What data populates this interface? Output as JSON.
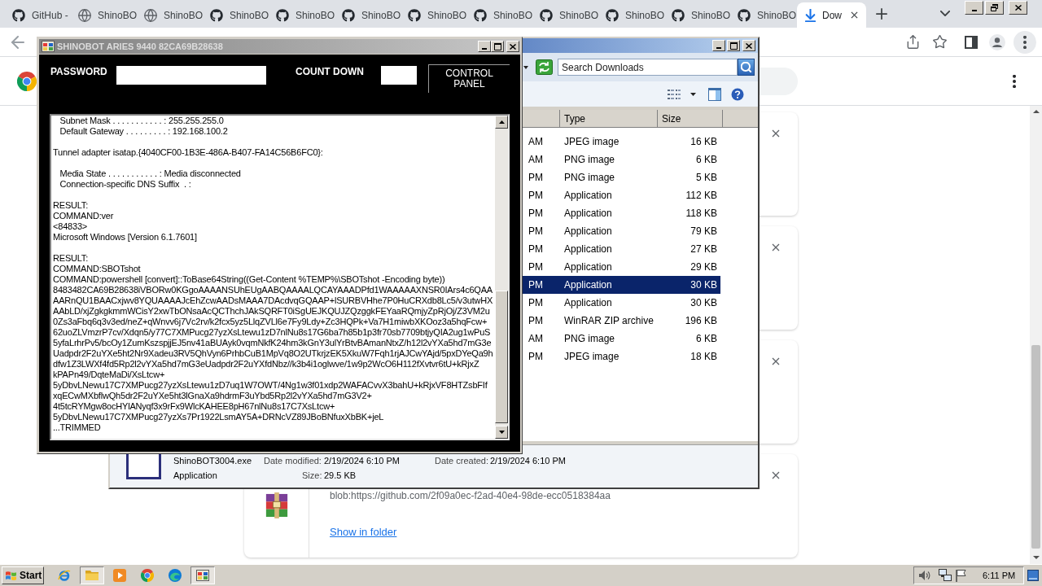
{
  "browser": {
    "tabs": [
      {
        "title": "GitHub -",
        "kind": "cat",
        "selected": false
      },
      {
        "title": "ShinoBO",
        "kind": "globe",
        "selected": false
      },
      {
        "title": "ShinoBO",
        "kind": "globe",
        "selected": false
      },
      {
        "title": "ShinoBO",
        "kind": "cat",
        "selected": false
      },
      {
        "title": "ShinoBO",
        "kind": "cat",
        "selected": false
      },
      {
        "title": "ShinoBO",
        "kind": "cat",
        "selected": false
      },
      {
        "title": "ShinoBO",
        "kind": "cat",
        "selected": false
      },
      {
        "title": "ShinoBO",
        "kind": "cat",
        "selected": false
      },
      {
        "title": "ShinoBO",
        "kind": "cat",
        "selected": false
      },
      {
        "title": "ShinoBO",
        "kind": "cat",
        "selected": false
      },
      {
        "title": "ShinoBO",
        "kind": "cat",
        "selected": false
      },
      {
        "title": "ShinoBO",
        "kind": "cat",
        "selected": false
      },
      {
        "title": "Dow",
        "kind": "download",
        "selected": true
      }
    ]
  },
  "downloads": {
    "cards": [
      {
        "kind": "covered"
      },
      {
        "kind": "covered"
      },
      {
        "kind": "covered"
      },
      {
        "kind": "file",
        "url": "blob:https://github.com/2f09a0ec-f2ad-40e4-98de-ecc0518384aa",
        "link": "Show in folder"
      }
    ]
  },
  "explorer": {
    "search": {
      "placeholder": "Search Downloads"
    },
    "columns": [
      "Type",
      "Size"
    ],
    "rows": [
      {
        "date": "AM",
        "type": "JPEG image",
        "size": "16 KB",
        "selected": false
      },
      {
        "date": "AM",
        "type": "PNG image",
        "size": "6 KB",
        "selected": false
      },
      {
        "date": "PM",
        "type": "PNG image",
        "size": "5 KB",
        "selected": false
      },
      {
        "date": "PM",
        "type": "Application",
        "size": "112 KB",
        "selected": false
      },
      {
        "date": "PM",
        "type": "Application",
        "size": "118 KB",
        "selected": false
      },
      {
        "date": "PM",
        "type": "Application",
        "size": "79 KB",
        "selected": false
      },
      {
        "date": "PM",
        "type": "Application",
        "size": "27 KB",
        "selected": false
      },
      {
        "date": "PM",
        "type": "Application",
        "size": "29 KB",
        "selected": false
      },
      {
        "date": "PM",
        "type": "Application",
        "size": "30 KB",
        "selected": true
      },
      {
        "date": "PM",
        "type": "Application",
        "size": "30 KB",
        "selected": false
      },
      {
        "date": "PM",
        "type": "WinRAR ZIP archive",
        "size": "196 KB",
        "selected": false
      },
      {
        "date": "AM",
        "type": "PNG image",
        "size": "6 KB",
        "selected": false
      },
      {
        "date": "PM",
        "type": "JPEG image",
        "size": "18 KB",
        "selected": false
      }
    ],
    "details": {
      "name": "ShinoBOT3004.exe",
      "modified_label": "Date modified:",
      "modified": "2/19/2024 6:10 PM",
      "created_label": "Date created:",
      "created": "2/19/2024 6:10 PM",
      "type": "Application",
      "size_label": "Size:",
      "size": "29.5 KB"
    }
  },
  "shinobot": {
    "title": "SHINOBOT ARIES 9440 82CA69B28638",
    "password_label": "PASSWORD",
    "countdown_label": "COUNT DOWN",
    "control_panel": "CONTROL PANEL",
    "console_blocks": [
      [
        "   Subnet Mask . . . . . . . . . . . : 255.255.255.0",
        "   Default Gateway . . . . . . . . . : 192.168.100.2"
      ],
      [
        "Tunnel adapter isatap.{4040CF00-1B3E-486A-B407-FA14C56B6FC0}:"
      ],
      [
        "   Media State . . . . . . . . . . . : Media disconnected",
        "   Connection-specific DNS Suffix  . :"
      ],
      [
        "RESULT:",
        "COMMAND:ver",
        "<84833>",
        "Microsoft Windows [Version 6.1.7601]"
      ],
      [
        "RESULT:",
        "COMMAND:SBOTshot",
        "COMMAND:powershell [convert]::ToBase64String((Get-Content %TEMP%\\SBOTshot -Encoding byte))",
        "8483482CA69B28638iVBORw0KGgoAAAANSUhEUgAABQAAAALQCAYAAADPfd1WAAAAAXNSR0IArs4c6QAA",
        "AARnQU1BAACxjwv8YQUAAAAJcEhZcwAADsMAAA7DAcdvqGQAAP+lSURBVHhe7P0HuCRXdb8Lc5/v3utwHX",
        "AAbLD/xjZgkgkmmWCisY2xwTbONsaAcQCThchJAkSQRFT0iSgUEJKQUJZQzggkFEYaaRQmjyZpRjOj/Z3VM2u",
        "0Zs3aFbq6q3v3ed/neZ+qWnvv6j7Vc2rv/k2fcx5yz5LlqZVLl6e7Fy9Ldy+Zc3HQPk+Va7H1miwbXKOoz3a5hqFcw+",
        "62uoZLVmzrP7cv/Xdqn5/y77C7XMPucg27yzXsLtewu1zD7nlNu8s17G6ba7h85b1p3fr70sb7709btjyQIA2ug1wPuS",
        "5yfaLrhrPv5/bcOy1ZumKszspjjEJ5nv41aBUAyk0vqmNkfK24hm3kGnY3ulYrBtvBAmanNtxZ/h12l2vYXa5hd7mG3e",
        "Uadpdr2F2uYXe5ht2Nr9Xadeu3RV5QhVyn6PrhbCuB1MpVq8O2UTkrjzEK5XkuW7Fqh1rjAJCwYAjd/5pxDYeQa9h",
        "dfw1Z3LWXf4fd5Rp2l2vYXa5hd7mG3eUadpdr2F2uYXfdNbz//k3b4i1oglwve/1w9p2WcO6H112fXvtvr6tU+kRjxZ",
        "kPAPn49/DqteMaDi/XsLtcw+",
        "5yDbvLNewu17C7XMPucg27yzXsLtewu1zD7uq1W7OWT/4Ng1w3f01xdp2WAFACvvX3bahU+kRjxVF8HTZsbFIf",
        "xqECwMXbflwQh5dr2F2uYXe5ht3lGnaXa9hdrmF3uYbd5Rp2l2vYXa5hd7mG3V2+",
        "4t5tcRYMgw8ocHYlANyqf3x9rFx9WlcKAHEE8pH67nlNu8s17C7XsLtcw+",
        "5yDbvLNewu17C7XMPucg27yzXs7Pr1922LsmAY5A+DRNcVZ89JBoBNfuxXbBK+jeL",
        "...TRIMMED"
      ]
    ]
  },
  "taskbar": {
    "start": "Start",
    "items": [
      {
        "kind": "web",
        "pressed": false
      },
      {
        "kind": "folder",
        "pressed": true
      },
      {
        "kind": "player",
        "pressed": false
      },
      {
        "kind": "wheel",
        "pressed": false
      },
      {
        "kind": "wave",
        "pressed": false
      },
      {
        "kind": "app",
        "pressed": true
      }
    ],
    "clock": "6:11 PM"
  }
}
